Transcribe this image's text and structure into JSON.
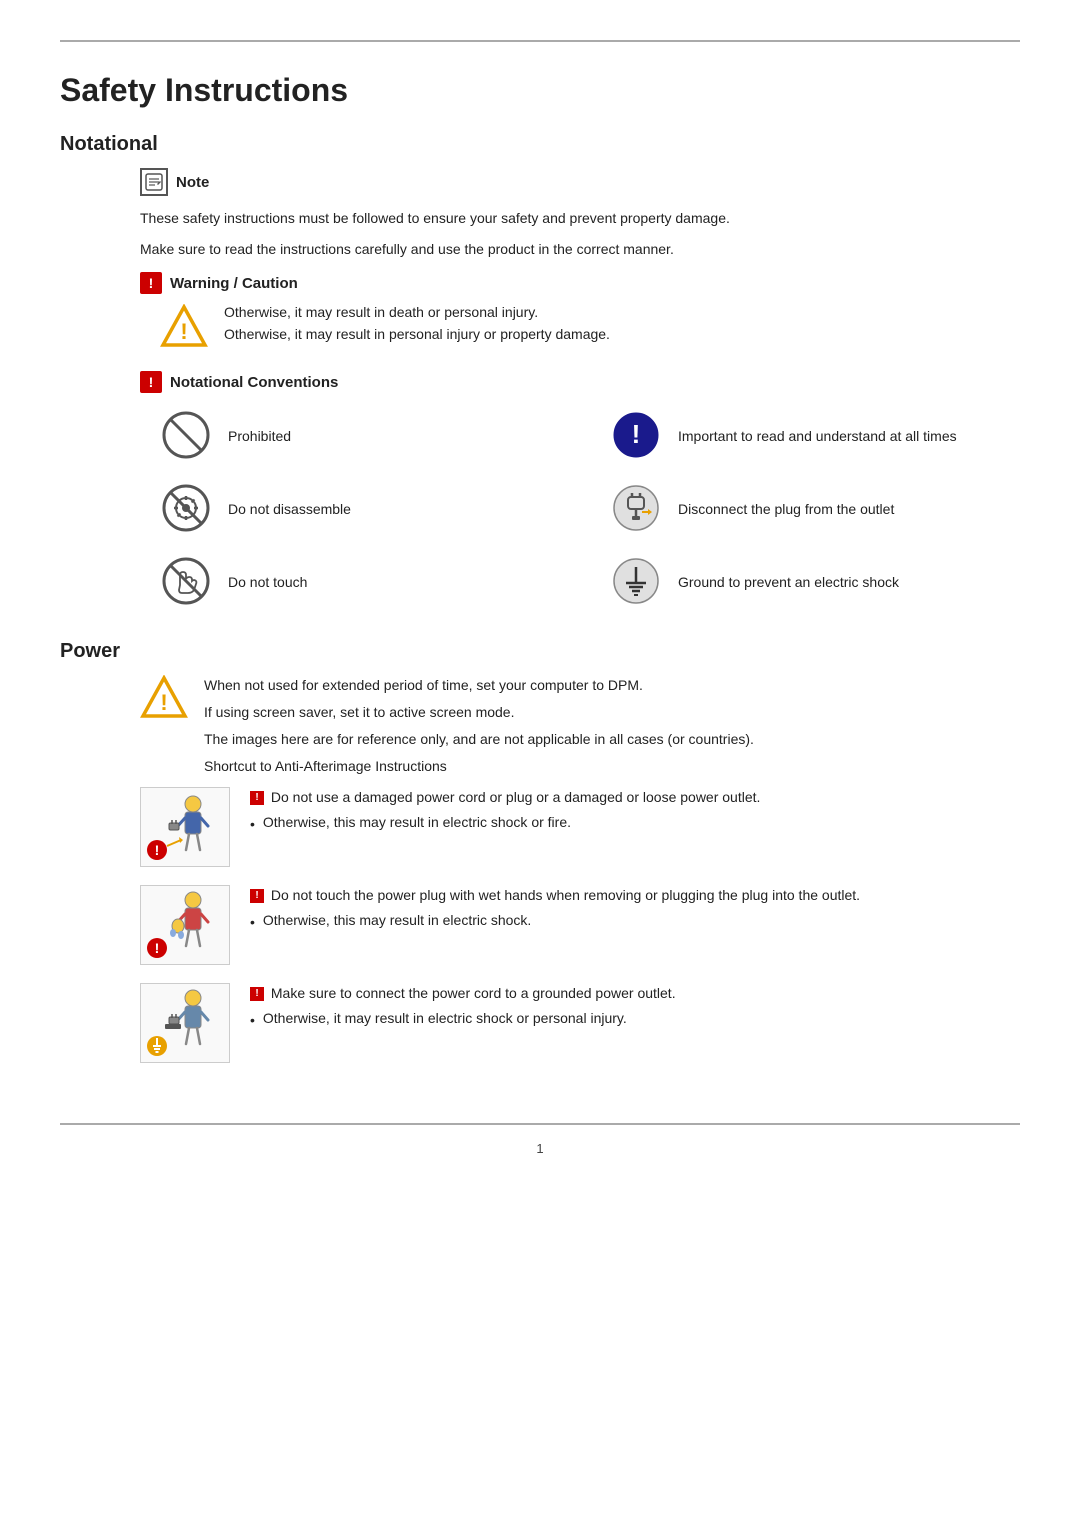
{
  "page": {
    "title": "Safety Instructions",
    "page_number": "1"
  },
  "notational": {
    "section_title": "Notational",
    "note_label": "Note",
    "note_text1": "These safety instructions must be followed to ensure your safety and prevent property damage.",
    "note_text2": "Make sure to read the instructions carefully and use the product in the correct manner.",
    "warning_caution_label": "Warning / Caution",
    "warning_text1": "Otherwise, it may result in death or personal injury.",
    "warning_text2": "Otherwise, it may result in personal injury or property damage.",
    "notational_conventions_label": "Notational Conventions",
    "icons": [
      {
        "label": "Prohibited",
        "position": "left"
      },
      {
        "label": "Important to read and understand at all times",
        "position": "right"
      },
      {
        "label": "Do not disassemble",
        "position": "left"
      },
      {
        "label": "Disconnect the plug from the outlet",
        "position": "right"
      },
      {
        "label": "Do not touch",
        "position": "left"
      },
      {
        "label": "Ground to prevent an electric shock",
        "position": "right"
      }
    ]
  },
  "power": {
    "section_title": "Power",
    "text1": "When not used for extended period of time, set your computer to DPM.",
    "text2": "If using screen saver, set it to active screen mode.",
    "text3": "The images here are for reference only, and are not applicable in all cases (or countries).",
    "text4": "Shortcut to Anti-Afterimage Instructions",
    "block1": {
      "icon_type": "prohibited-red",
      "text_main": "Do not use a damaged power cord or plug or a damaged or loose power outlet.",
      "bullet": "Otherwise, this may result in electric shock or fire."
    },
    "block2": {
      "icon_type": "prohibited-red",
      "text_main": "Do not touch the power plug with wet hands when removing or plugging the plug into the outlet.",
      "bullet": "Otherwise, this may result in electric shock."
    },
    "block3": {
      "icon_type": "ground-red",
      "text_main": "Make sure to connect the power cord to a grounded power outlet.",
      "bullet": "Otherwise, it may result in electric shock or personal injury."
    }
  }
}
